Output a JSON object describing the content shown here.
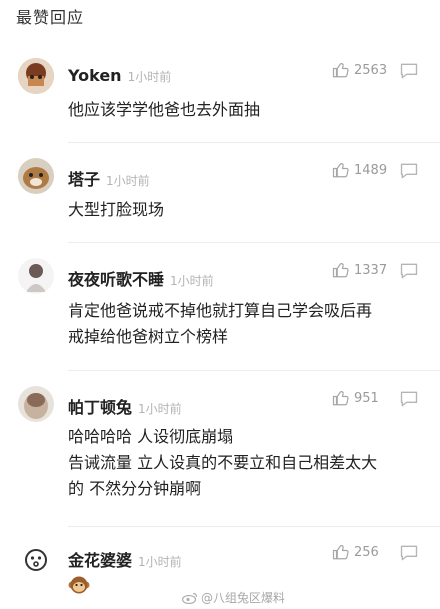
{
  "section_title": "最赞回应",
  "comments": [
    {
      "username": "Yoken",
      "time": "1小时前",
      "likes": "2563",
      "lines": [
        "他应该学学他爸也去外面抽"
      ]
    },
    {
      "username": "塔子",
      "time": "1小时前",
      "likes": "1489",
      "lines": [
        "大型打脸现场"
      ]
    },
    {
      "username": "夜夜听歌不睡",
      "time": "1小时前",
      "likes": "1337",
      "lines": [
        "肯定他爸说戒不掉他就打算自己学会吸后再",
        "戒掉给他爸树立个榜样"
      ]
    },
    {
      "username": "帕丁顿兔",
      "time": "1小时前",
      "likes": "951",
      "lines": [
        "哈哈哈哈 人设彻底崩塌",
        "告诫流量 立人设真的不要立和自己相差太大",
        "的 不然分分钟崩啊"
      ]
    },
    {
      "username": "金花婆婆",
      "time": "1小时前",
      "likes": "256",
      "lines": []
    }
  ],
  "watermark": "@八组兔区爆料",
  "colors": {
    "icon_gray": "#a6a6a6",
    "time_gray": "#b3b3b3",
    "divider": "#ececec"
  }
}
